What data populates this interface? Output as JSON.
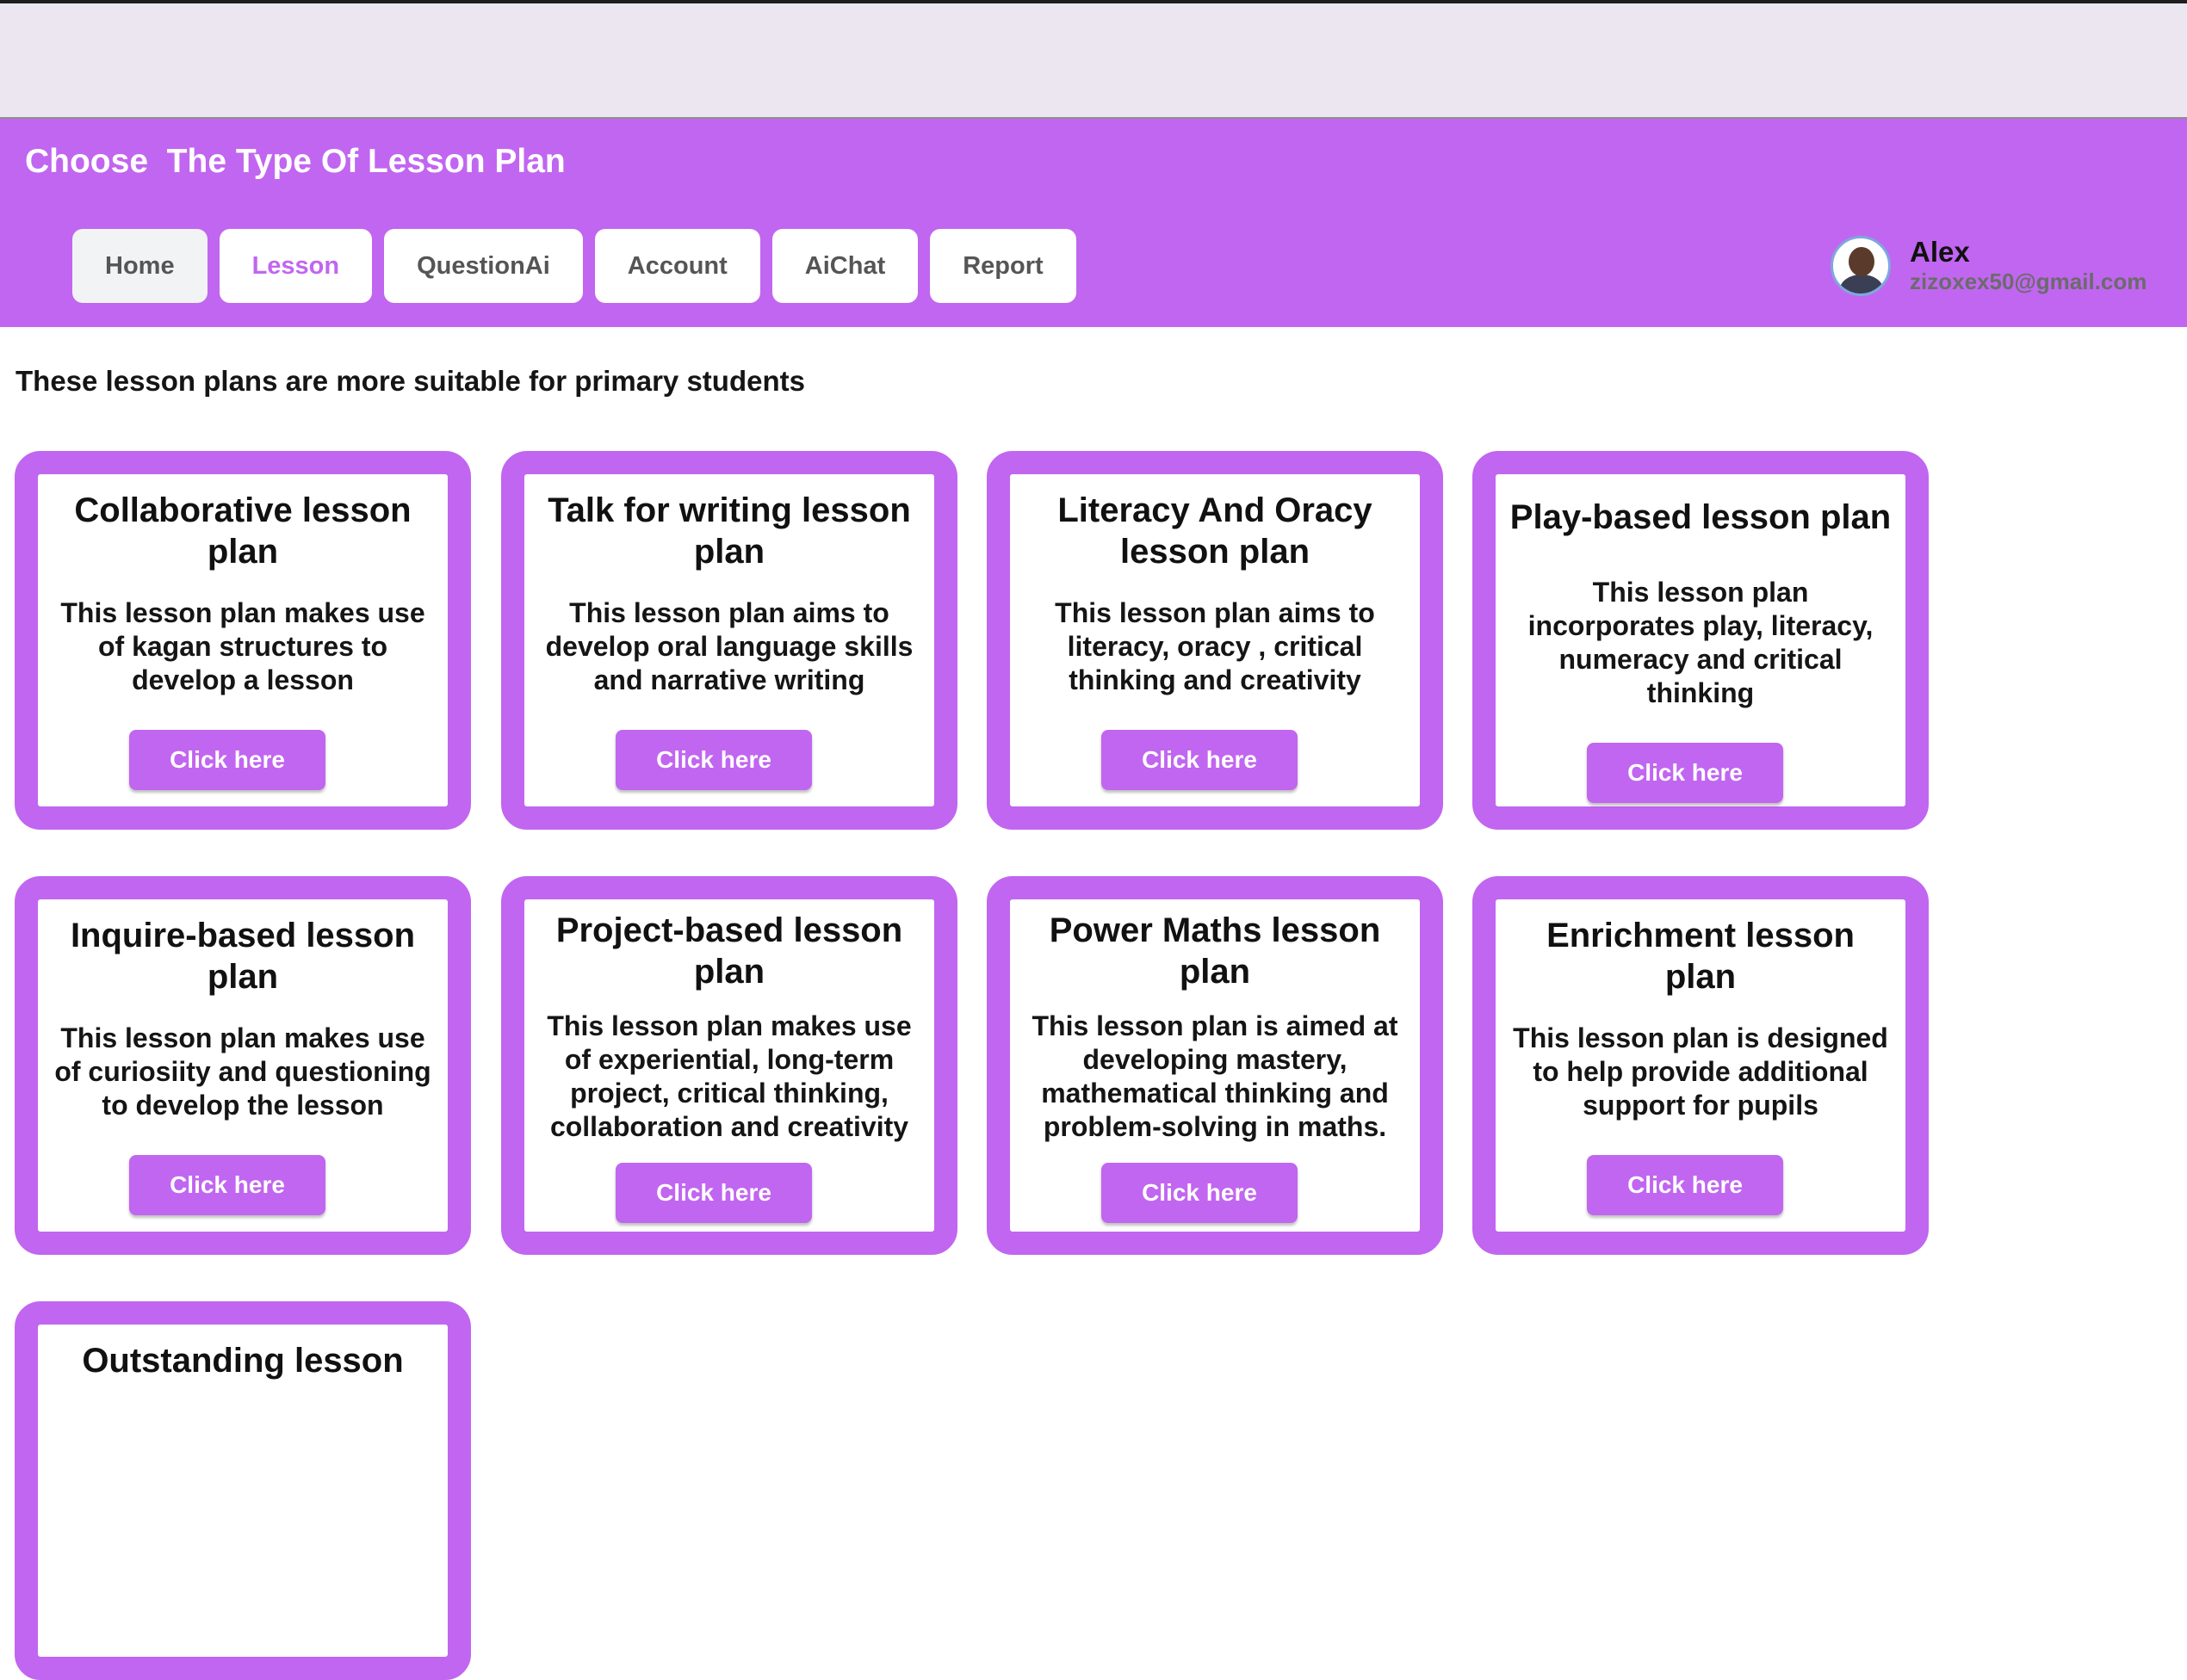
{
  "header": {
    "title": "Choose  The Type Of Lesson Plan",
    "nav": [
      "Home",
      "Lesson",
      "QuestionAi",
      "Account",
      "AiChat",
      "Report"
    ],
    "active_nav": "Lesson"
  },
  "user": {
    "name": "Alex",
    "email": "zizoxex50@gmail.com"
  },
  "main": {
    "subtitle": "These lesson plans are more suitable for primary students",
    "cards": [
      {
        "title": "Collaborative lesson plan",
        "desc": "This lesson plan makes use of kagan structures to develop a lesson",
        "button": "Click here"
      },
      {
        "title": "Talk for writing lesson plan",
        "desc": "This lesson plan aims to develop oral language skills and narrative writing",
        "button": "Click here"
      },
      {
        "title": "Literacy And Oracy lesson plan",
        "desc": "This lesson plan aims to literacy, oracy , critical thinking and creativity",
        "button": "Click here"
      },
      {
        "title": "Play-based lesson plan",
        "desc": "This lesson plan incorporates play, literacy, numeracy and critical thinking",
        "button": "Click here"
      },
      {
        "title": "Inquire-based lesson plan",
        "desc": "This lesson plan makes use of curiosiity and questioning to develop the lesson",
        "button": "Click here"
      },
      {
        "title": "Project-based lesson plan",
        "desc": "This lesson plan makes use of experiential, long-term project, critical thinking, collaboration and creativity",
        "button": "Click here"
      },
      {
        "title": "Power Maths lesson plan",
        "desc": "This lesson plan is aimed at developing mastery, mathematical thinking and problem-solving in maths.",
        "button": "Click here"
      },
      {
        "title": "Enrichment lesson plan",
        "desc": "This lesson plan is designed to help provide additional support for pupils",
        "button": "Click here"
      },
      {
        "title": "Outstanding lesson",
        "desc": "",
        "button": ""
      }
    ]
  },
  "colors": {
    "accent": "#c166f0",
    "top_bar": "#ece6f0",
    "nav_home_bg": "#f1f3f5"
  }
}
